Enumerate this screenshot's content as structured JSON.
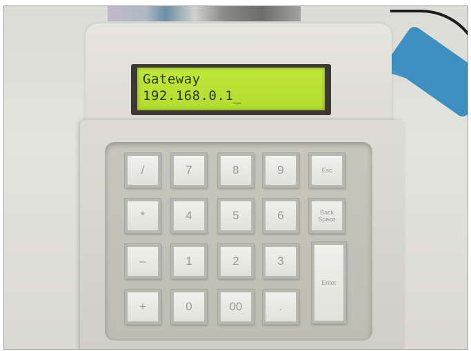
{
  "lcd": {
    "line1": "Gateway",
    "line2": "192.168.0.1_"
  },
  "keys": {
    "slash": "/",
    "seven": "7",
    "eight": "8",
    "nine": "9",
    "esc": "Esc",
    "asterisk": "*",
    "four": "4",
    "five": "5",
    "six": "6",
    "back_space_1": "Back",
    "back_space_2": "Space",
    "minus": "–",
    "one": "1",
    "two": "2",
    "three": "3",
    "enter": "Enter",
    "plus": "+",
    "zero": "0",
    "double_zero": "00",
    "dot": "."
  },
  "colors": {
    "lcd_background": "#b8e032",
    "lcd_text": "#2a3a10",
    "device_body": "#dcdcd5",
    "key_face": "#ececE8",
    "cable_blue": "#3f97c8"
  }
}
